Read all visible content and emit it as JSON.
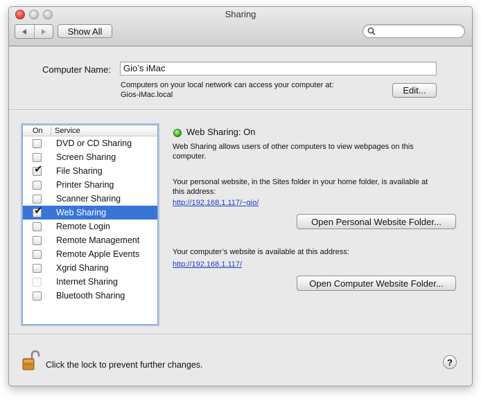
{
  "window": {
    "title": "Sharing"
  },
  "toolbar": {
    "back_icon": "back-arrow-icon",
    "forward_icon": "forward-arrow-icon",
    "show_all_label": "Show All",
    "search_placeholder": ""
  },
  "computer_name": {
    "label": "Computer Name:",
    "value": "Gio’s iMac",
    "info_line1": "Computers on your local network can access your computer at:",
    "info_line2": "Gios-iMac.local",
    "edit_label": "Edit..."
  },
  "services": {
    "header_on": "On",
    "header_service": "Service",
    "items": [
      {
        "name": "DVD or CD Sharing",
        "checked": false,
        "selected": false,
        "enabled": true
      },
      {
        "name": "Screen Sharing",
        "checked": false,
        "selected": false,
        "enabled": true
      },
      {
        "name": "File Sharing",
        "checked": true,
        "selected": false,
        "enabled": true
      },
      {
        "name": "Printer Sharing",
        "checked": false,
        "selected": false,
        "enabled": true
      },
      {
        "name": "Scanner Sharing",
        "checked": false,
        "selected": false,
        "enabled": true
      },
      {
        "name": "Web Sharing",
        "checked": true,
        "selected": true,
        "enabled": true
      },
      {
        "name": "Remote Login",
        "checked": false,
        "selected": false,
        "enabled": true
      },
      {
        "name": "Remote Management",
        "checked": false,
        "selected": false,
        "enabled": true
      },
      {
        "name": "Remote Apple Events",
        "checked": false,
        "selected": false,
        "enabled": true
      },
      {
        "name": "Xgrid Sharing",
        "checked": false,
        "selected": false,
        "enabled": true
      },
      {
        "name": "Internet Sharing",
        "checked": false,
        "selected": false,
        "enabled": false
      },
      {
        "name": "Bluetooth Sharing",
        "checked": false,
        "selected": false,
        "enabled": true
      }
    ]
  },
  "detail": {
    "status_title": "Web Sharing: On",
    "status_color": "#3fae1f",
    "description_line1": "Web Sharing allows users of other computers to view webpages on this",
    "description_line2": "computer.",
    "personal_line1": "Your personal website, in the Sites folder in your home folder, is available at",
    "personal_line2": "this address:",
    "personal_url": "http://192.168.1.117/~gio/",
    "open_personal_label": "Open Personal Website Folder...",
    "computer_line": "Your computer’s website is available at this address:",
    "computer_url": "http://192.168.1.117/",
    "open_computer_label": "Open Computer Website Folder..."
  },
  "footer": {
    "lock_icon": "unlocked-padlock-icon",
    "lock_text": "Click the lock to prevent further changes.",
    "help_label": "?"
  },
  "colors": {
    "selection": "#3875d7",
    "link": "#1a3fc5",
    "window_bg": "#e9e9e9"
  }
}
